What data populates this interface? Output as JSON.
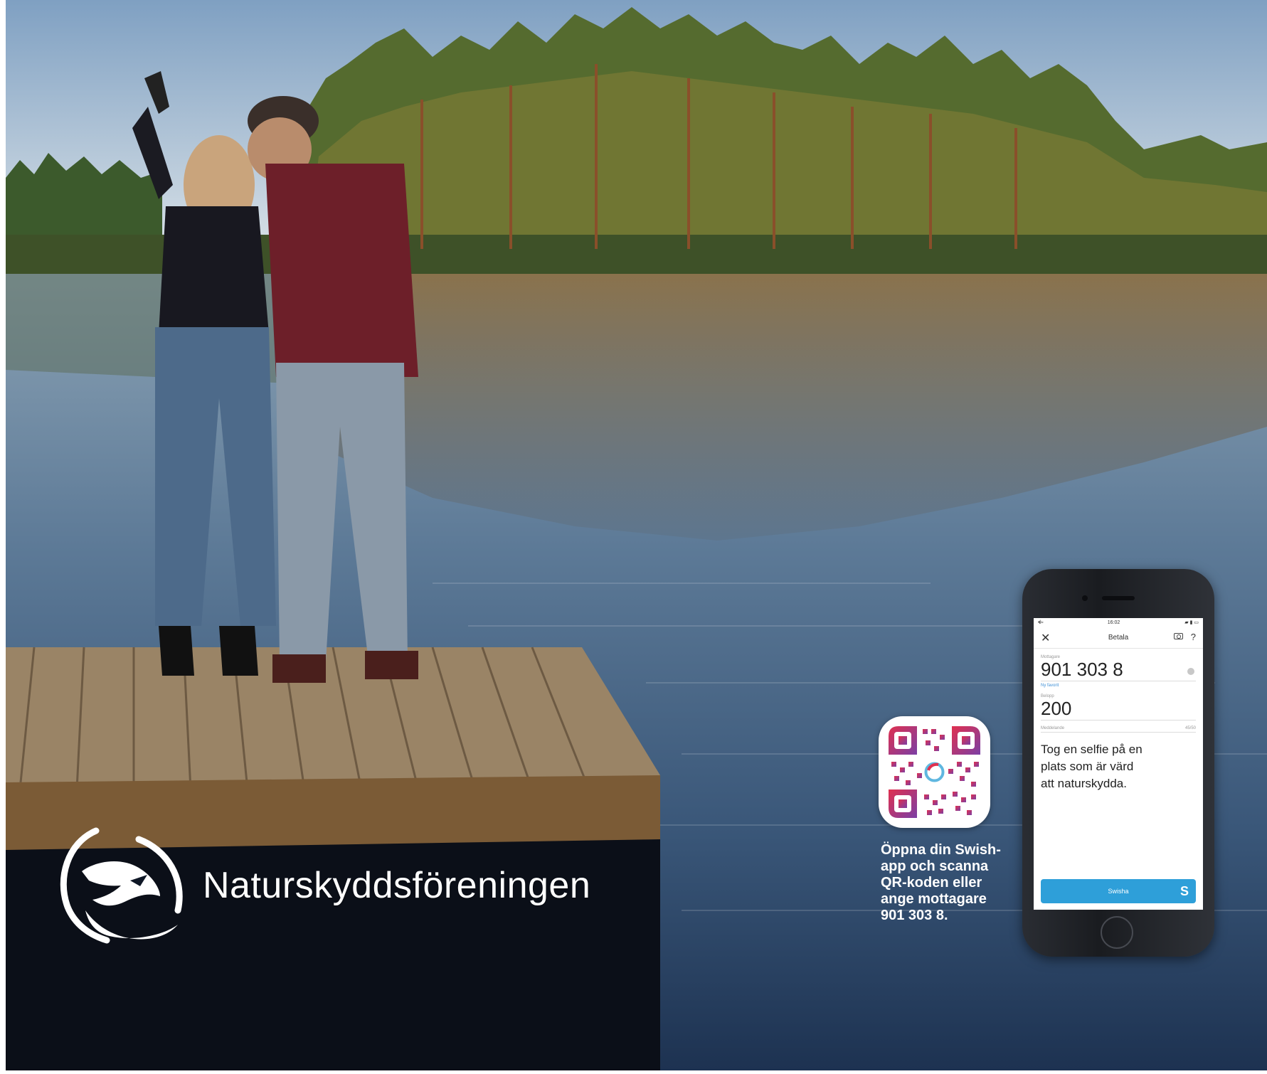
{
  "brand": {
    "logo_icon": "swallow-logo-icon",
    "name": "Naturskyddsföreningen"
  },
  "qr": {
    "icon": "swish-qr-code-icon",
    "caption": "Öppna din Swish-\napp och scanna\nQR-koden eller\nange mottagare\n901 303 8."
  },
  "phone": {
    "status_time": "16:02",
    "status_signal": "•ıl ≈",
    "status_battery": "▰ ▮ ▭",
    "nav": {
      "close_icon": "close-icon",
      "title": "Betala",
      "camera_icon": "camera-icon",
      "help": "?"
    },
    "recipient": {
      "label": "Mottagare",
      "value": "901 303 8",
      "link": "Ny favorit"
    },
    "amount": {
      "label": "Belopp",
      "value": "200"
    },
    "message": {
      "label": "Meddelande",
      "counter": "45/50",
      "text": "Tog en selfie på en\nplats som är värd\natt naturskydda."
    },
    "button": {
      "label": "Swisha",
      "logo": "S"
    }
  },
  "colors": {
    "swish_blue": "#2e9fd9",
    "qr_gradient_start": "#e0304f",
    "qr_gradient_end": "#7b3fa5"
  }
}
